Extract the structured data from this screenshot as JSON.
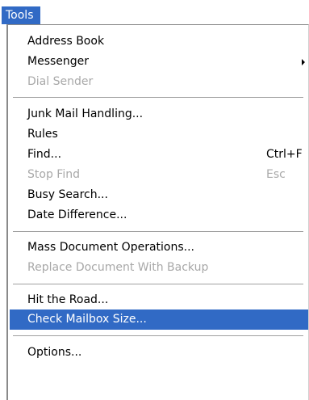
{
  "menubar": {
    "tools_label": "Tools"
  },
  "menu": {
    "address_book": "Address Book",
    "messenger": "Messenger",
    "dial_sender": "Dial Sender",
    "junk_mail": "Junk Mail Handling...",
    "rules": "Rules",
    "find": "Find...",
    "find_shortcut": "Ctrl+F",
    "stop_find": "Stop Find",
    "stop_find_shortcut": "Esc",
    "busy_search": "Busy Search...",
    "date_difference": "Date Difference...",
    "mass_document": "Mass Document Operations...",
    "replace_document": "Replace Document With Backup",
    "hit_the_road": "Hit the Road...",
    "check_mailbox": "Check Mailbox Size...",
    "options": "Options..."
  },
  "icons": {
    "submenu_arrow": "submenu-arrow-icon"
  },
  "colors": {
    "highlight": "#316ac5",
    "disabled_text": "#a8a8a8"
  }
}
